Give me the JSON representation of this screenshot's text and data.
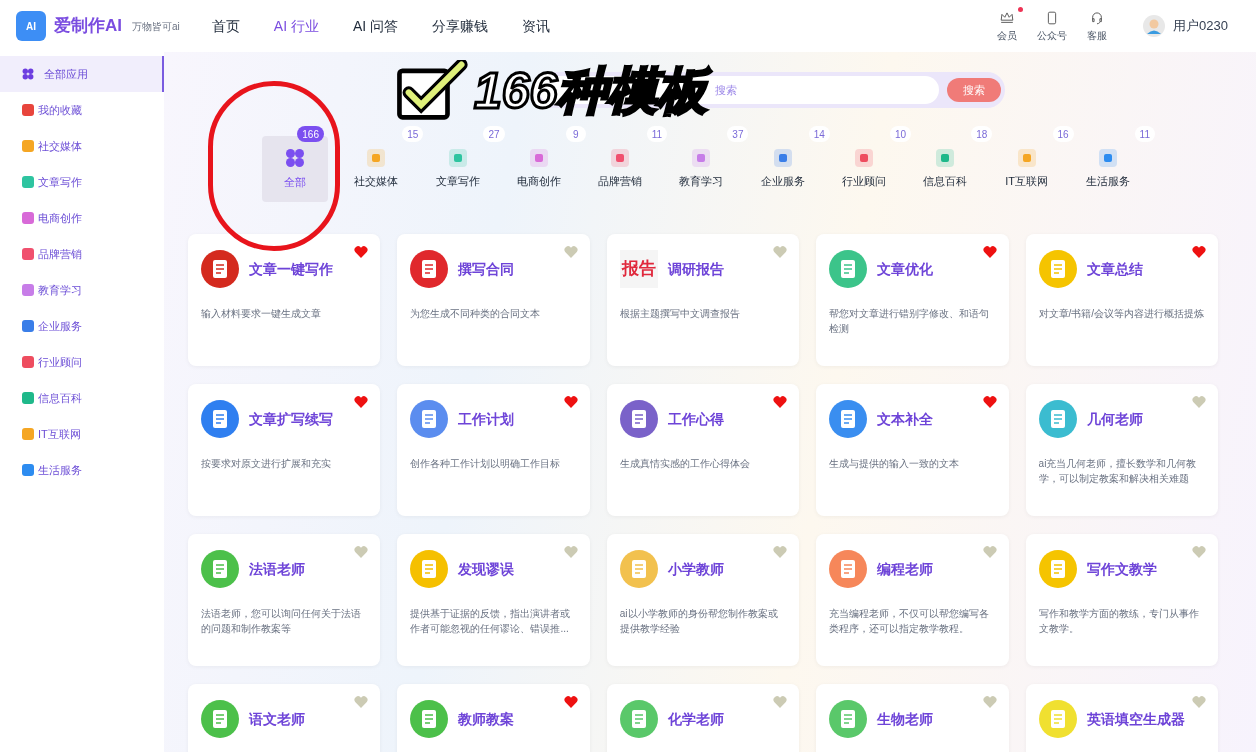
{
  "brand": {
    "logo": "AI",
    "name": "爱制作AI",
    "slogan": "万物皆可ai"
  },
  "nav": [
    {
      "label": "首页",
      "selected": false
    },
    {
      "label": "AI 行业",
      "selected": true
    },
    {
      "label": "AI 问答",
      "selected": false
    },
    {
      "label": "分享赚钱",
      "selected": false
    },
    {
      "label": "资讯",
      "selected": false
    }
  ],
  "header_actions": [
    {
      "kind": "crown",
      "label": "会员",
      "notify": true
    },
    {
      "kind": "phone",
      "label": "公众号",
      "notify": false
    },
    {
      "kind": "headset",
      "label": "客服",
      "notify": false
    }
  ],
  "user": {
    "name": "用户0230"
  },
  "sidebar": [
    {
      "kind": "all",
      "label": "全部应用",
      "color": "#6c3ce0",
      "selected": true
    },
    {
      "kind": "category",
      "label": "我的收藏",
      "color": "#e8453c",
      "selected": false
    },
    {
      "kind": "category",
      "label": "社交媒体",
      "color": "#f5a623",
      "selected": false
    },
    {
      "kind": "category",
      "label": "文章写作",
      "color": "#2ec4a0",
      "selected": false
    },
    {
      "kind": "category",
      "label": "电商创作",
      "color": "#d86ad8",
      "selected": false
    },
    {
      "kind": "category",
      "label": "品牌营销",
      "color": "#f0506e",
      "selected": false
    },
    {
      "kind": "category",
      "label": "教育学习",
      "color": "#c77de8",
      "selected": false
    },
    {
      "kind": "category",
      "label": "企业服务",
      "color": "#3a7ee8",
      "selected": false
    },
    {
      "kind": "category",
      "label": "行业顾问",
      "color": "#ee4d5f",
      "selected": false
    },
    {
      "kind": "category",
      "label": "信息百科",
      "color": "#1fb88a",
      "selected": false
    },
    {
      "kind": "category",
      "label": "IT互联网",
      "color": "#f5a623",
      "selected": false
    },
    {
      "kind": "category",
      "label": "生活服务",
      "color": "#2d8cf0",
      "selected": false
    }
  ],
  "search": {
    "placeholder": "搜索",
    "button": "搜索"
  },
  "sticker": {
    "text": "166种模板"
  },
  "categories": [
    {
      "kind": "all",
      "label": "全部",
      "count": "166",
      "color": "#7b4ff0",
      "selected": true
    },
    {
      "kind": "category",
      "label": "社交媒体",
      "count": "15",
      "color": "#f5a623",
      "selected": false
    },
    {
      "kind": "category",
      "label": "文章写作",
      "count": "27",
      "color": "#2ec4a0",
      "selected": false
    },
    {
      "kind": "category",
      "label": "电商创作",
      "count": "9",
      "color": "#d86ad8",
      "selected": false
    },
    {
      "kind": "category",
      "label": "品牌营销",
      "count": "11",
      "color": "#f0506e",
      "selected": false
    },
    {
      "kind": "category",
      "label": "教育学习",
      "count": "37",
      "color": "#c77de8",
      "selected": false
    },
    {
      "kind": "category",
      "label": "企业服务",
      "count": "14",
      "color": "#3a7ee8",
      "selected": false
    },
    {
      "kind": "category",
      "label": "行业顾问",
      "count": "10",
      "color": "#ee4d5f",
      "selected": false
    },
    {
      "kind": "category",
      "label": "信息百科",
      "count": "18",
      "color": "#1fb88a",
      "selected": false
    },
    {
      "kind": "category",
      "label": "IT互联网",
      "count": "16",
      "color": "#f5a623",
      "selected": false
    },
    {
      "kind": "category",
      "label": "生活服务",
      "count": "11",
      "color": "#2d8cf0",
      "selected": false
    }
  ],
  "cards": [
    {
      "kind": "circle",
      "title": "文章一键写作",
      "description": "输入材料要求一键生成文章",
      "favorite": true,
      "color": "#d42a1e"
    },
    {
      "kind": "circle",
      "title": "撰写合同",
      "description": "为您生成不同种类的合同文本",
      "favorite": false,
      "color": "#e0282c"
    },
    {
      "kind": "text",
      "icon_text": "报告",
      "title": "调研报告",
      "description": "根据主题撰写中文调查报告",
      "favorite": false,
      "color": "#e0283c"
    },
    {
      "kind": "circle",
      "title": "文章优化",
      "description": "帮您对文章进行错别字修改、和语句检测",
      "favorite": true,
      "color": "#3cc48a"
    },
    {
      "kind": "circle",
      "title": "文章总结",
      "description": "对文章/书籍/会议等内容进行概括提炼",
      "favorite": true,
      "color": "#f5c400"
    },
    {
      "kind": "circle",
      "title": "文章扩写续写",
      "description": "按要求对原文进行扩展和充实",
      "favorite": true,
      "color": "#2f7ff0"
    },
    {
      "kind": "circle",
      "title": "工作计划",
      "description": "创作各种工作计划以明确工作目标",
      "favorite": true,
      "color": "#5b8def"
    },
    {
      "kind": "circle",
      "title": "工作心得",
      "description": "生成真情实感的工作心得体会",
      "favorite": true,
      "color": "#7a62c9"
    },
    {
      "kind": "circle",
      "title": "文本补全",
      "description": "生成与提供的输入一致的文本",
      "favorite": true,
      "color": "#3a8ef0"
    },
    {
      "kind": "circle",
      "title": "几何老师",
      "description": "ai充当几何老师，擅长数学和几何教学，可以制定教案和解决相关难题",
      "favorite": false,
      "color": "#3bbcd0"
    },
    {
      "kind": "circle",
      "title": "法语老师",
      "description": "法语老师，您可以询问任何关于法语的问题和制作教案等",
      "favorite": false,
      "color": "#4cc04a"
    },
    {
      "kind": "circle",
      "title": "发现谬误",
      "description": "提供基于证据的反馈，指出演讲者或作者可能忽视的任何谬论、错误推...",
      "favorite": false,
      "color": "#f5c000"
    },
    {
      "kind": "circle",
      "title": "小学教师",
      "description": "ai以小学教师的身份帮您制作教案或提供教学经验",
      "favorite": false,
      "color": "#f2c14e"
    },
    {
      "kind": "circle",
      "title": "编程老师",
      "description": "充当编程老师，不仅可以帮您编写各类程序，还可以指定教学教程。",
      "favorite": false,
      "color": "#f6875a"
    },
    {
      "kind": "circle",
      "title": "写作文教学",
      "description": "写作和教学方面的教练，专门从事作文教学。",
      "favorite": false,
      "color": "#f5c400"
    },
    {
      "kind": "circle",
      "title": "语文老师",
      "favorite": false,
      "color": "#4cc04a"
    },
    {
      "kind": "circle",
      "title": "教师教案",
      "favorite": true,
      "color": "#4cc04a"
    },
    {
      "kind": "circle",
      "title": "化学老师",
      "favorite": false,
      "color": "#5ac86a"
    },
    {
      "kind": "circle",
      "title": "生物老师",
      "favorite": false,
      "color": "#5ac86a"
    },
    {
      "kind": "circle",
      "title": "英语填空生成器",
      "favorite": false,
      "color": "#f0e030"
    }
  ]
}
